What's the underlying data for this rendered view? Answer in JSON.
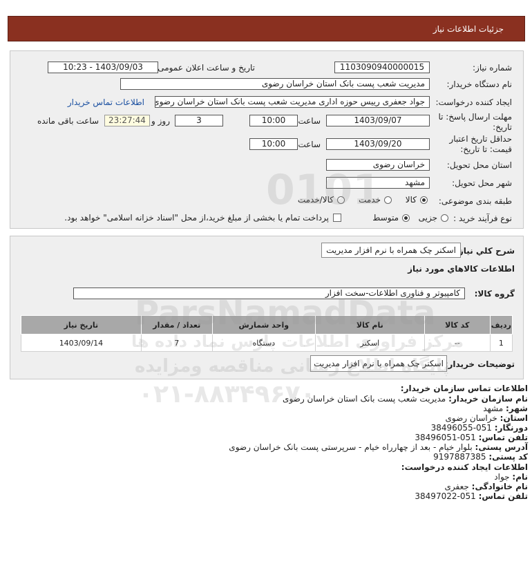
{
  "header": {
    "title": "جزئیات اطلاعات نیاز"
  },
  "form": {
    "need_number_label": "شماره نیاز:",
    "need_number": "1103090940000015",
    "announce_label": "تاریخ و ساعت اعلان عمومی:",
    "announce_value": "1403/09/03 - 10:23",
    "buyer_org_label": "نام دستگاه خریدار:",
    "buyer_org": "مدیریت شعب پست بانک استان خراسان رضوی",
    "creator_label": "ایجاد کننده درخواست:",
    "creator": "جواد جعفری رییس حوزه اداری مدیریت شعب پست بانک استان خراسان رضوی",
    "contact_link": "اطلاعات تماس خریدار",
    "deadline_label_1": "مهلت ارسال پاسخ: تا",
    "deadline_label_2": "تاریخ:",
    "deadline_date": "1403/09/07",
    "time_label": "ساعت",
    "deadline_time": "10:00",
    "days_value": "3",
    "days_label": "روز و",
    "remaining_time": "23:27:44",
    "remaining_label": "ساعت باقی مانده",
    "validity_label_1": "حداقل تاریخ اعتبار",
    "validity_label_2": "قیمت: تا تاریخ:",
    "validity_date": "1403/09/20",
    "validity_time": "10:00",
    "province_label": "استان محل تحویل:",
    "province": "خراسان رضوی",
    "city_label": "شهر محل تحویل:",
    "city": "مشهد",
    "category_label": "طبقه بندی موضوعی:",
    "category_options": [
      "کالا",
      "خدمت",
      "کالا/خدمت"
    ],
    "category_selected": "کالا",
    "process_label": "نوع فرآیند خرید :",
    "process_options": [
      "جزیی",
      "متوسط"
    ],
    "process_selected": "متوسط",
    "payment_text": "پرداخت تمام یا بخشی از مبلغ خرید،از محل \"اسناد خزانه اسلامی\" خواهد بود."
  },
  "details": {
    "description_label": "شرح کلي نياز:",
    "description": "اسکنر چک همراه با نرم افزار مدیریت",
    "goods_title": "اطلاعات کالاهاي مورد نياز",
    "group_label": "گروه کالا:",
    "group_value": "کامپیوتر و فناوری اطلاعات-سخت افزار",
    "table": {
      "headers": [
        "ردیف",
        "کد کالا",
        "نام کالا",
        "واحد شمارش",
        "تعداد / مقدار",
        "تاریخ نیاز"
      ],
      "rows": [
        [
          "1",
          "--",
          "اسکنر",
          "دستگاه",
          "7",
          "1403/09/14"
        ]
      ]
    },
    "buyer_notes_label": "توضیحات خریدار:",
    "buyer_notes": "اسکنر چک همراه با نرم افزار مدیریت"
  },
  "contact": {
    "title": "اطلاعات تماس سازمان خریدار:",
    "org_label": "نام سازمان خریدار:",
    "org": "مدیریت شعب پست بانک استان خراسان رضوی",
    "city_label": "شهر:",
    "city": "مشهد",
    "province_label": "استان:",
    "province": "خراسان رضوی",
    "fax_label": "دورنگار:",
    "fax": "051-38496055",
    "phone_label": "تلفن تماس:",
    "phone": "051-38496051",
    "address_label": "آدرس پستی:",
    "address": "بلوار خیام - بعد از چهارراه خیام - سرپرستی پست بانک خراسان رضوی",
    "postal_label": "کد پستی:",
    "postal": "9197887385",
    "creator_title": "اطلاعات ایجاد کننده درخواست:",
    "name_label": "نام:",
    "name": "جواد",
    "family_label": "نام خانوادگی:",
    "family": "جعفری",
    "creator_phone_label": "تلفن تماس:",
    "creator_phone": "051-38497022"
  },
  "watermark": {
    "brand": "ParsNamadData",
    "line1": "مرکز فراوری اطلاعات پارس نماد داده ها",
    "line2": "پایگاه اطلاع رسانی مناقصه ومزایده",
    "phone": "۰۲۱-۸۸۳۴۹۶۷۰",
    "digits": "0101"
  }
}
